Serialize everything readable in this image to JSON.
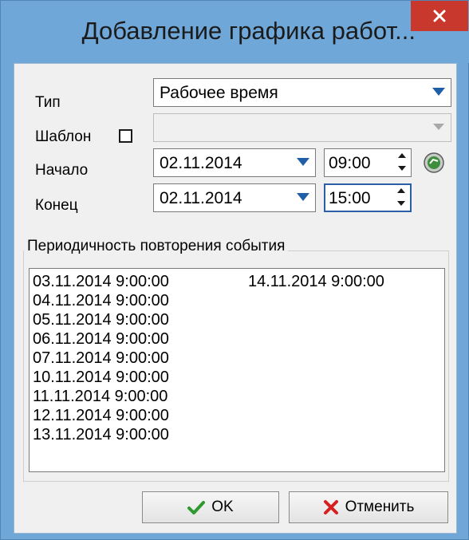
{
  "window": {
    "title": "Добавление графика работ...",
    "close_label": "×"
  },
  "form": {
    "type_label": "Тип",
    "type_value": "Рабочее время",
    "template_label": "Шаблон",
    "template_checked": false,
    "template_value": "",
    "start_label": "Начало",
    "start_date": "02.11.2014",
    "start_time": "09:00",
    "end_label": "Конец",
    "end_date": "02.11.2014",
    "end_time": "15:00"
  },
  "recurrence": {
    "title": "Периодичность повторения события",
    "column1": [
      "03.11.2014 9:00:00",
      "04.11.2014 9:00:00",
      "05.11.2014 9:00:00",
      "06.11.2014 9:00:00",
      "07.11.2014 9:00:00",
      "10.11.2014 9:00:00",
      "11.11.2014 9:00:00",
      "12.11.2014 9:00:00",
      "13.11.2014 9:00:00"
    ],
    "column2": [
      "14.11.2014 9:00:00"
    ]
  },
  "buttons": {
    "ok_label": "OK",
    "cancel_label": "Отменить"
  },
  "colors": {
    "titlebar": "#6fa7d8",
    "close": "#c9382c",
    "dropdown_arrow": "#1f5fa8",
    "ok_check": "#2e9a2e",
    "cancel_x": "#d42020"
  },
  "icons": {
    "refresh": "clock-refresh-icon",
    "ok": "checkmark-icon",
    "cancel": "red-x-icon"
  }
}
